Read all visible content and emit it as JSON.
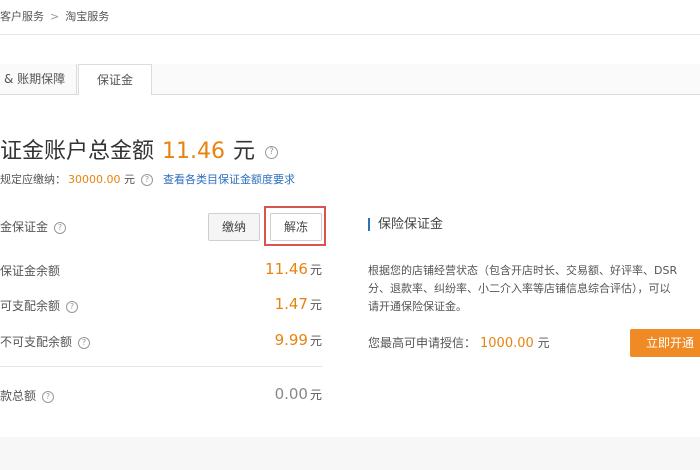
{
  "breadcrumb": {
    "item1": "客户服务",
    "separator": ">",
    "item2": "淘宝服务"
  },
  "tabs": [
    {
      "label": "& 账期保障"
    },
    {
      "label": "保证金"
    }
  ],
  "heading": {
    "prefix": "证金账户总金额",
    "amount": "11.46",
    "unit": "元"
  },
  "requirement": {
    "label": "规定应缴纳：",
    "value": "30000.00",
    "unit": "元",
    "link": "查看各类目保证金额度要求"
  },
  "cash_deposit": {
    "title": "金保证金",
    "pay_button": "缴纳",
    "unfreeze_button": "解冻",
    "rows": [
      {
        "label": "保证金余额",
        "value": "11.46",
        "unit": "元"
      },
      {
        "label": "可支配余额",
        "value": "1.47",
        "unit": "元"
      },
      {
        "label": "不可支配余额",
        "value": "9.99",
        "unit": "元"
      }
    ],
    "total": {
      "label": "款总额",
      "value": "0.00",
      "unit": "元"
    }
  },
  "insurance": {
    "title": "保险保证金",
    "desc_lines": [
      "根据您的店铺经营状态（包含开店时长、交易额、好评率、DSR",
      "分、退款率、纠纷率、小二介入率等店铺信息综合评估），可以",
      "请开通保险保证金。"
    ],
    "credit_label": "您最高可申请授信：",
    "credit_value": "1000.00",
    "credit_unit": "元",
    "apply_button": "立即开通"
  },
  "colors": {
    "accent_orange": "#e8830f",
    "link_blue": "#2f6fbf",
    "highlight_red": "#d9534f",
    "button_orange": "#f08a24"
  }
}
